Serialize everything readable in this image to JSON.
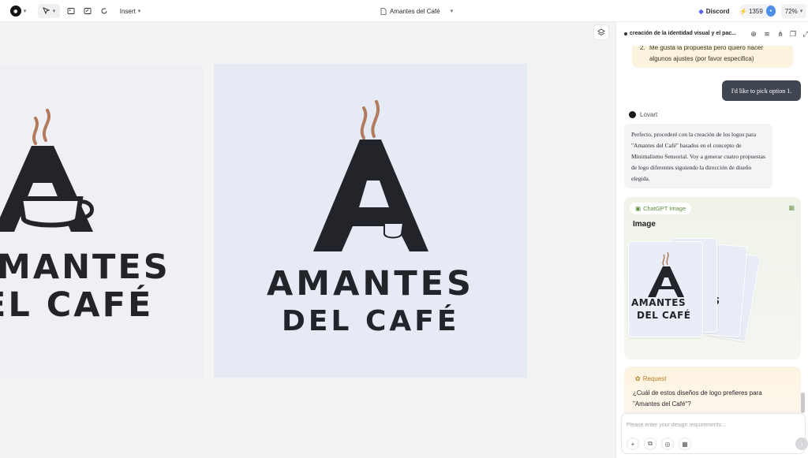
{
  "topbar": {
    "insert_label": "Insert",
    "document_title": "Amantes del Café",
    "discord_label": "Discord",
    "credits": "1359",
    "zoom": "72%"
  },
  "canvas": {
    "artboard_left": {
      "line1": "MANTES",
      "line2": "EL CAFÉ"
    },
    "artboard_main": {
      "line1": "AMANTES",
      "line2": "DEL CAFÉ"
    }
  },
  "panel": {
    "chat_title": "creación de la identidad visual y el pac...",
    "option_item": {
      "index": "2.",
      "text": "Me gusta la propuesta pero quiero hacer algunos ajustes (por favor especifica)"
    },
    "user_message": "I'd like to pick option 1.",
    "bot_name": "Lovart",
    "bot_message": "Perfecto, procederé con la creación de los logos para \"Amantes del Café\" basados en el concepto de Minimalismo Sensorial. Voy a generar cuatro propuestas de logo diferentes siguiendo la dirección de diseño elegida.",
    "image_card": {
      "badge": "ChatGPT Image",
      "title": "Image",
      "thumb_line1": "AMANTES",
      "thumb_line2": "DEL CAFÉ",
      "thumb_back": "ÉS"
    },
    "request_card": {
      "badge": "Request",
      "text": "¿Cuál de estos diseños de logo prefieres para \"Amantes del Café\"?"
    },
    "input_placeholder": "Please enter your design requirements..."
  },
  "colors": {
    "accent": "#4d8ee8",
    "logo_dark": "#23232a",
    "steam": "#b27b5d",
    "user_bubble": "#3f4651"
  }
}
